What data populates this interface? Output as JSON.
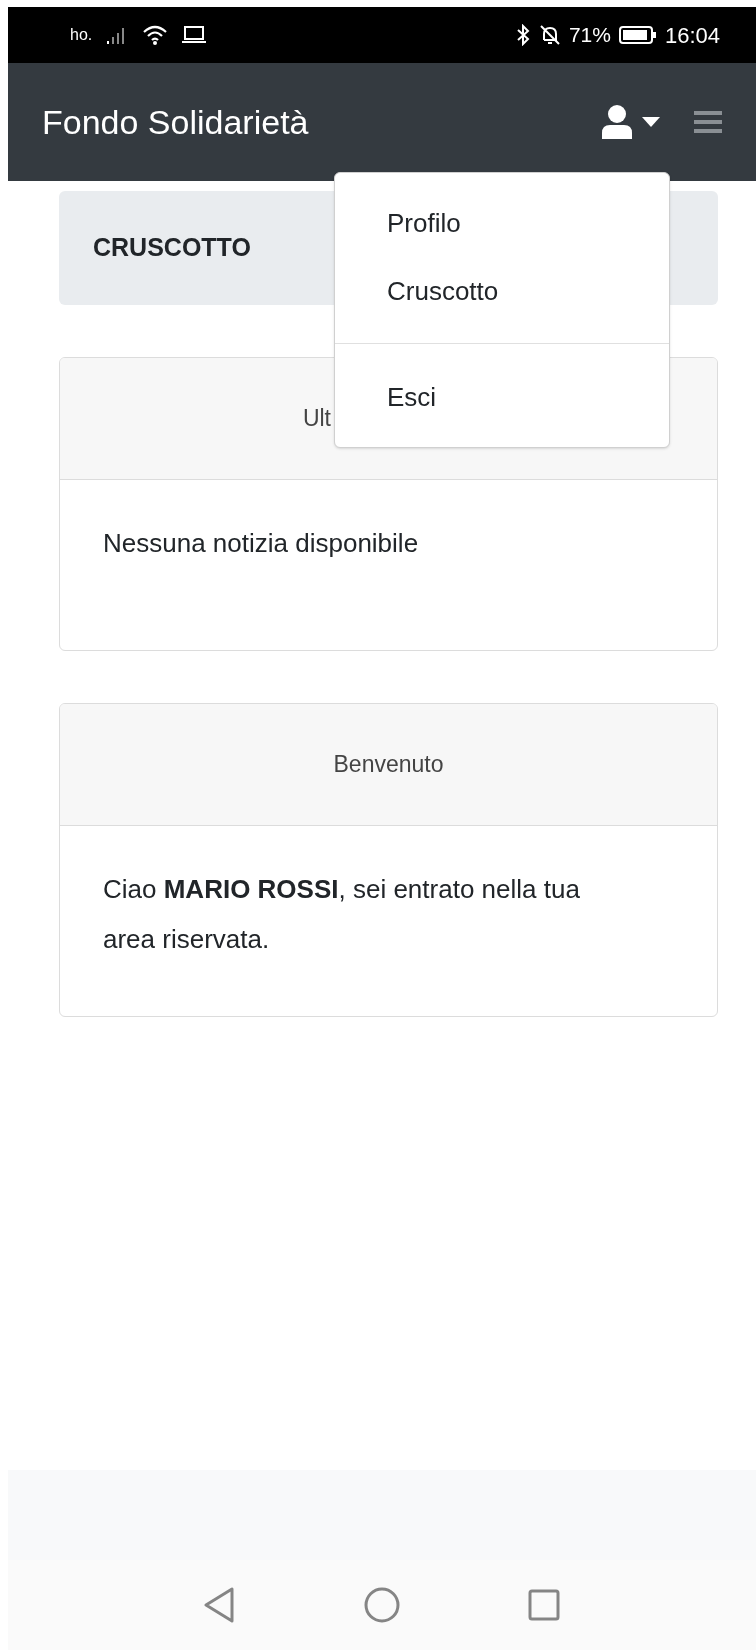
{
  "status_bar": {
    "carrier": "ho.",
    "battery": "71%",
    "time": "16:04"
  },
  "navbar": {
    "title": "Fondo Solidarietà"
  },
  "user_menu": {
    "groups": [
      {
        "items": [
          "Profilo",
          "Cruscotto"
        ]
      },
      {
        "items": [
          "Esci"
        ]
      }
    ]
  },
  "breadcrumb": "CRUSCOTTO",
  "cards": [
    {
      "header": "Ult",
      "clipped": true,
      "body": "Nessuna notizia disponibile"
    },
    {
      "header": "Benvenuto",
      "clipped": false,
      "body": "Ciao **MARIO ROSSI**, sei entrato nella tua area riservata."
    }
  ]
}
